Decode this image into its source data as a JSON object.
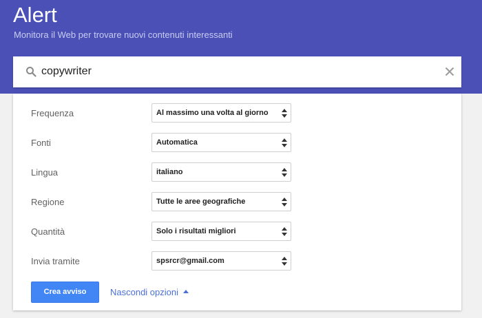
{
  "header": {
    "title": "Alert",
    "subtitle": "Monitora il Web per trovare nuovi contenuti interessanti"
  },
  "search": {
    "value": "copywriter",
    "icon": "search-icon",
    "clear_icon": "close-icon"
  },
  "options": [
    {
      "label": "Frequenza",
      "value": "Al massimo una volta al giorno"
    },
    {
      "label": "Fonti",
      "value": "Automatica"
    },
    {
      "label": "Lingua",
      "value": "italiano"
    },
    {
      "label": "Regione",
      "value": "Tutte le aree geografiche"
    },
    {
      "label": "Quantità",
      "value": "Solo i risultati migliori"
    },
    {
      "label": "Invia tramite",
      "value": "spsrcr@gmail.com"
    }
  ],
  "actions": {
    "create_label": "Crea avviso",
    "hide_options_label": "Nascondi opzioni"
  },
  "colors": {
    "header_bg": "#4a50b6",
    "primary_button": "#4285f4",
    "link": "#4a6fd8"
  }
}
